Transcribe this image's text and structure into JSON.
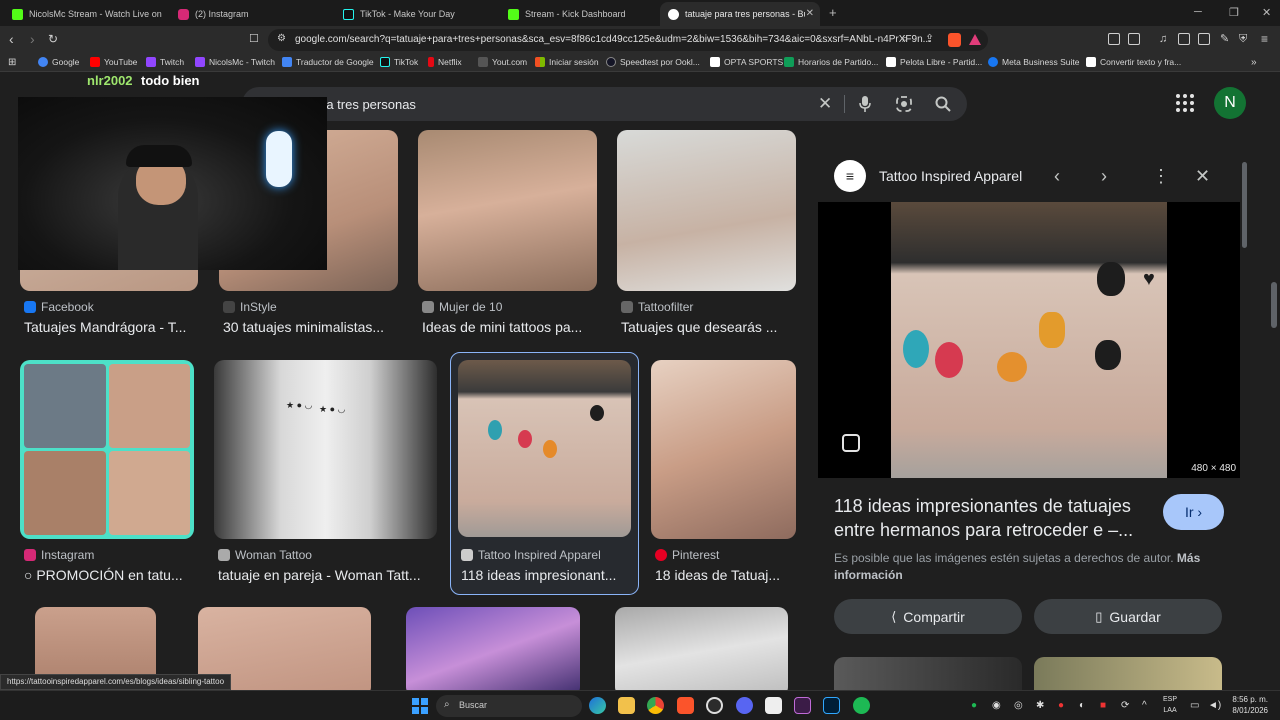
{
  "tabs": [
    {
      "title": "NicolsMc Stream - Watch Live on Ki",
      "color": "#53fc18"
    },
    {
      "title": "(2) Instagram",
      "color": "#d62976"
    },
    {
      "title": "TikTok - Make Your Day",
      "color": "#111111"
    },
    {
      "title": "Stream - Kick Dashboard",
      "color": "#53fc18"
    },
    {
      "title": "tatuaje para tres personas - Busc",
      "color": "#ffffff"
    }
  ],
  "url": "google.com/search?q=tatuaje+para+tres+personas&sca_esv=8f86c1cd49cc125e&udm=2&biw=1536&bih=734&aic=0&sxsrf=ANbL-n4PrXF9n...",
  "bookmarks": [
    {
      "label": "Google",
      "color": "#4285f4"
    },
    {
      "label": "YouTube",
      "color": "#ff0000"
    },
    {
      "label": "Twitch",
      "color": "#9146ff"
    },
    {
      "label": "NicolsMc - Twitch",
      "color": "#9146ff"
    },
    {
      "label": "Traductor de Google",
      "color": "#4285f4"
    },
    {
      "label": "TikTok",
      "color": "#111111"
    },
    {
      "label": "Netflix",
      "color": "#e50914"
    },
    {
      "label": "Yout.com",
      "color": "#333333"
    },
    {
      "label": "Iniciar sesión",
      "color": "#f4b400"
    },
    {
      "label": "Speedtest por Ookl...",
      "color": "#141526"
    },
    {
      "label": "OPTA SPORTS",
      "color": "#ffffff"
    },
    {
      "label": "Horarios de Partido...",
      "color": "#0f9d58"
    },
    {
      "label": "Pelota Libre - Partid...",
      "color": "#ffffff"
    },
    {
      "label": "Meta Business Suite",
      "color": "#1877f2"
    },
    {
      "label": "Convertir texto y fra...",
      "color": "#ffffff"
    }
  ],
  "chat": {
    "user": "nlr2002",
    "message": "todo bien"
  },
  "search": {
    "query": "ra tres personas"
  },
  "account": {
    "initial": "N"
  },
  "results": [
    {
      "source": "Facebook",
      "caption": "Tatuajes Mandrágora - T...",
      "icon_color": "#1877f2"
    },
    {
      "source": "InStyle",
      "caption": "30 tatuajes minimalistas...",
      "icon_color": "#444444"
    },
    {
      "source": "Mujer de 10",
      "caption": "Ideas de mini tattoos pa...",
      "icon_color": "#888888"
    },
    {
      "source": "Tattoofilter",
      "caption": "Tatuajes que desearás ...",
      "icon_color": "#666666"
    },
    {
      "source": "Instagram",
      "caption": "○ PROMOCIÓN en tatu...",
      "icon_color": "#d62976"
    },
    {
      "source": "Woman Tattoo",
      "caption": "tatuaje en pareja - Woman Tatt...",
      "icon_color": "#aaaaaa"
    },
    {
      "source": "Tattoo Inspired Apparel",
      "caption": "118 ideas impresionant...",
      "icon_color": "#cccccc"
    },
    {
      "source": "Pinterest",
      "caption": "18 ideas de Tatuaj...",
      "icon_color": "#e60023"
    }
  ],
  "panel": {
    "source": "Tattoo Inspired Apparel",
    "dimensions": "480 × 480",
    "title": "118 ideas impresionantes de tatuajes entre hermanos para retroceder e –...",
    "go_label": "Ir",
    "copyright_note": "Es posible que las imágenes estén sujetas a derechos de autor.",
    "more_info": "Más información",
    "share_label": "Compartir",
    "save_label": "Guardar"
  },
  "status_url": "https://tattooinspiredapparel.com/es/blogs/ideas/sibling-tattoo",
  "taskbar": {
    "search_label": "Buscar",
    "language": "ESP",
    "region": "LAA",
    "time": "8:56 p. m.",
    "date": "8/01/2026"
  }
}
